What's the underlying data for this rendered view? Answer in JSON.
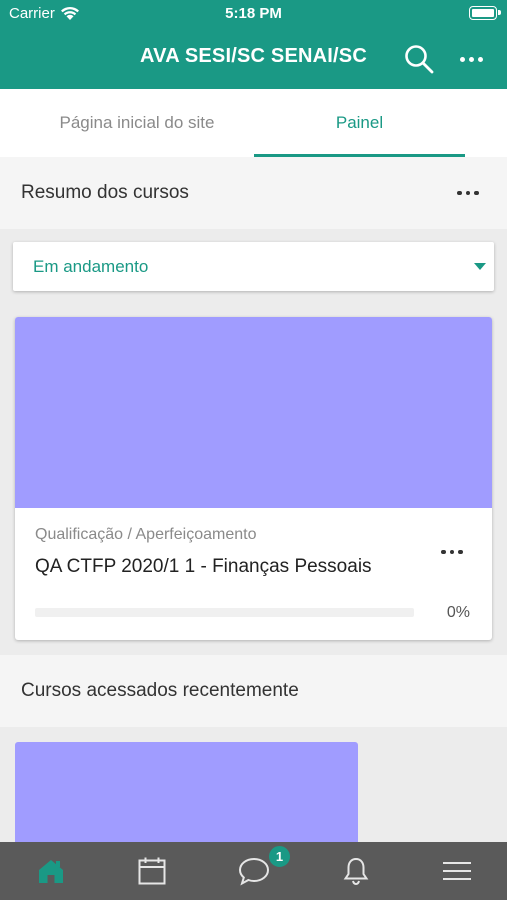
{
  "status_bar": {
    "carrier": "Carrier",
    "time": "5:18 PM"
  },
  "header": {
    "title": "AVA SESI/SC SENAI/SC"
  },
  "tabs": [
    {
      "label": "Página inicial do site",
      "active": false
    },
    {
      "label": "Painel",
      "active": true
    }
  ],
  "courses_section": {
    "title": "Resumo dos cursos",
    "filter": {
      "selected": "Em andamento"
    },
    "course": {
      "category": "Qualificação / Aperfeiçoamento",
      "name": "QA CTFP 2020/1 1 - Finanças Pessoais",
      "progress_text": "0%",
      "progress": 0,
      "image_color": "#a09cff"
    }
  },
  "recent_section": {
    "title": "Cursos acessados recentemente"
  },
  "tabbar": {
    "items": [
      {
        "icon": "home-icon",
        "active": true
      },
      {
        "icon": "calendar-icon",
        "active": false
      },
      {
        "icon": "messages-icon",
        "active": false
      },
      {
        "icon": "bell-icon",
        "active": false
      },
      {
        "icon": "menu-icon",
        "active": false
      }
    ],
    "messages_badge": "1"
  },
  "colors": {
    "primary": "#1a9985",
    "tabbar": "#5a5a5a",
    "course_image": "#a09cff"
  }
}
